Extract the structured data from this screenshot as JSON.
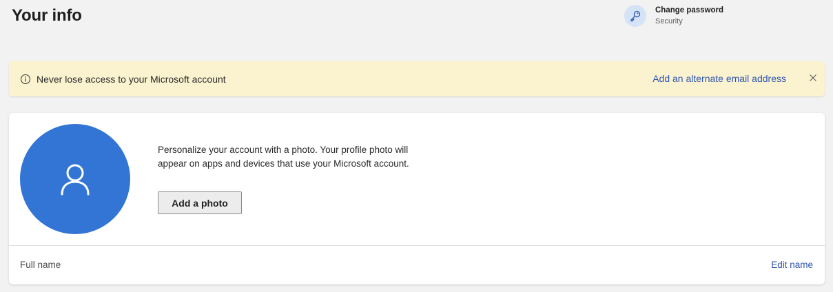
{
  "header": {
    "title": "Your info"
  },
  "quick_link": {
    "icon": "key-icon",
    "title": "Change password",
    "subtitle": "Security"
  },
  "banner": {
    "icon": "info-icon",
    "message": "Never lose access to your Microsoft account",
    "action_label": "Add an alternate email address",
    "close_icon": "close-icon",
    "background_color": "#fbf3cf"
  },
  "profile_card": {
    "avatar_icon": "person-icon",
    "avatar_color": "#3275d4",
    "description": "Personalize your account with a photo. Your profile photo will appear on apps and devices that use your Microsoft account.",
    "add_photo_label": "Add a photo",
    "full_name_label": "Full name",
    "edit_name_label": "Edit name"
  },
  "colors": {
    "link": "#2f55b0",
    "page_background": "#f2f2f2"
  }
}
